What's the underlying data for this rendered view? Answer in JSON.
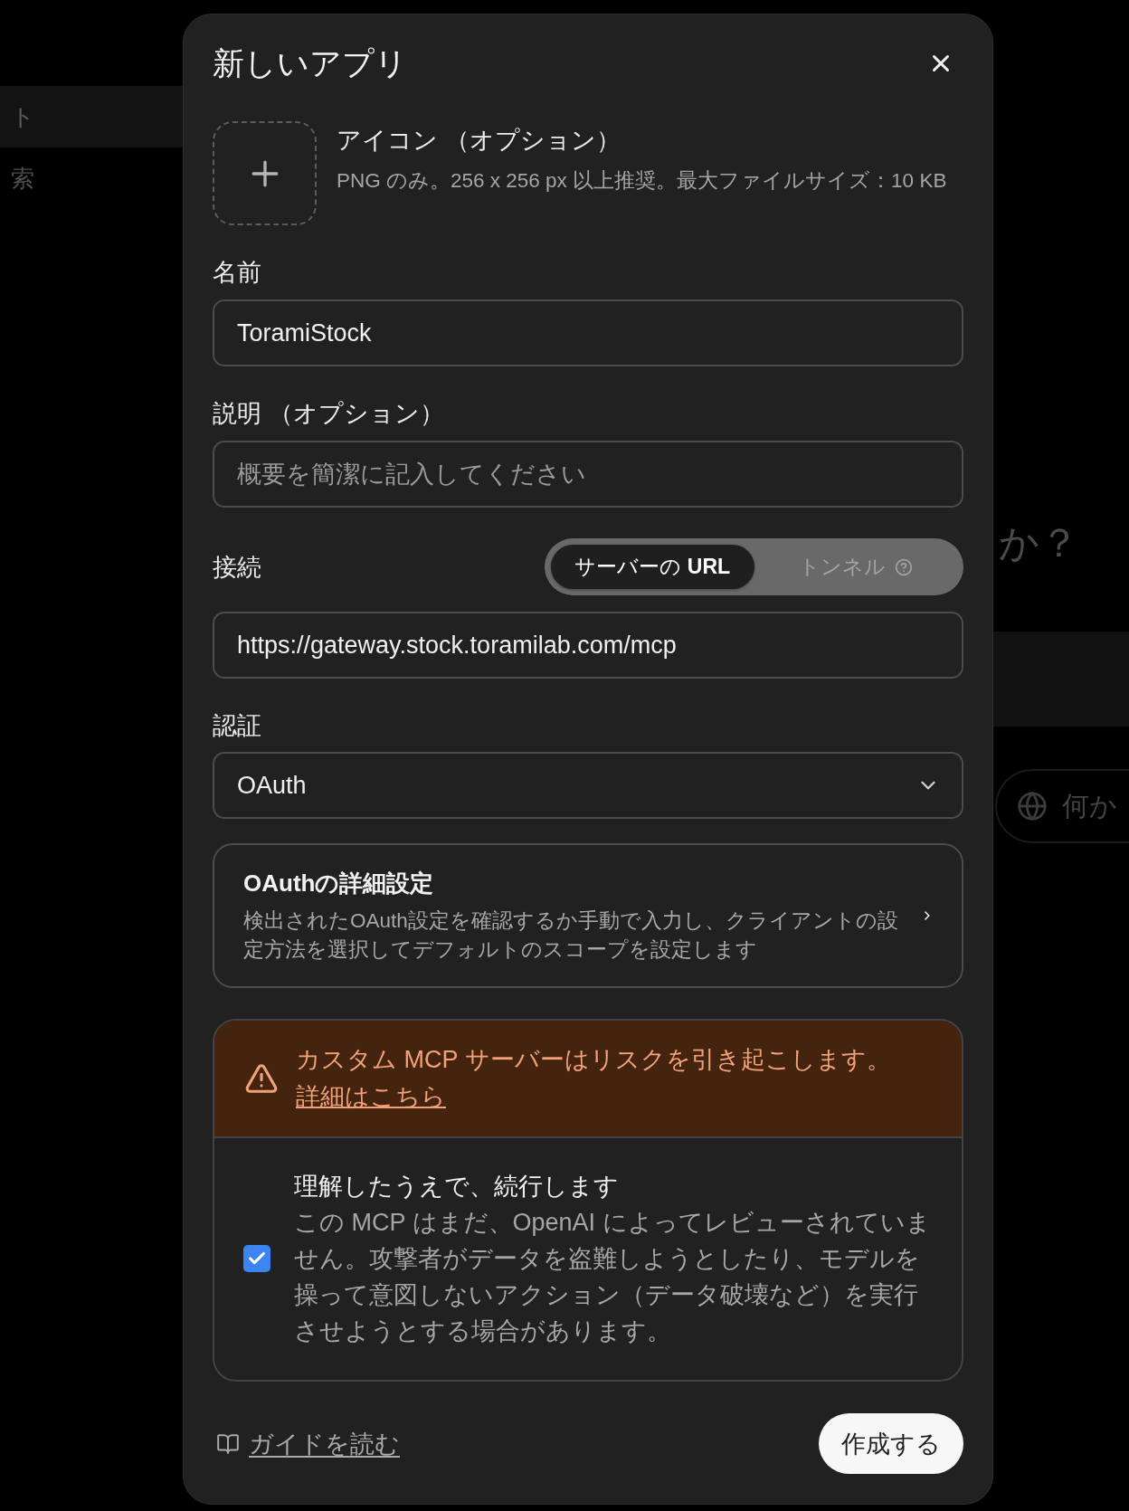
{
  "background": {
    "sidebar_items": [
      {
        "label": "ト",
        "selected": true
      },
      {
        "label": "索",
        "selected": false
      }
    ],
    "heading": "か？",
    "prompt_field": {
      "placeholder": "何か"
    }
  },
  "dialog": {
    "title": "新しいアプリ",
    "icon_upload": {
      "label": "アイコン （オプション）",
      "hint": "PNG のみ。256 x 256 px 以上推奨。最大ファイルサイズ：10 KB"
    },
    "name": {
      "label": "名前",
      "value": "ToramiStock"
    },
    "description": {
      "label": "説明 （オプション）",
      "placeholder": "概要を簡潔に記入してください"
    },
    "connection": {
      "label": "接続",
      "options": [
        {
          "label": "サーバーの **URL**",
          "selected": true,
          "help": false
        },
        {
          "label": "トンネル",
          "selected": false,
          "help": true
        }
      ],
      "value": "https://gateway.stock.toramilab.com/mcp"
    },
    "auth": {
      "label": "認証",
      "value": "OAuth"
    },
    "oauth_settings": {
      "title": "OAuthの詳細設定",
      "description": "検出されたOAuth設定を確認するか手動で入力し、クライアントの設定方法を選択してデフォルトのスコープを設定します"
    },
    "warning": {
      "text": "カスタム MCP サーバーはリスクを引き起こします。",
      "link": "詳細はこちら"
    },
    "acknowledge": {
      "checked": true,
      "title": "理解したうえで、続行します",
      "body": "この MCP はまだ、OpenAI によってレビューされていません。攻撃者がデータを盗難しようとしたり、モデルを操って意図しないアクション（データ破壊など）を実行させようとする場合があります。"
    },
    "guide_link": "ガイドを読む",
    "create_button": "作成する"
  }
}
